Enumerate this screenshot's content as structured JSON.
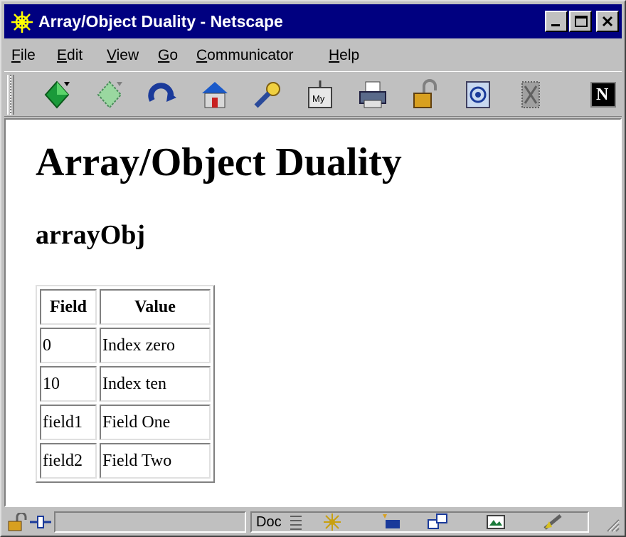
{
  "window": {
    "title": "Array/Object Duality - Netscape",
    "accent": "#000080"
  },
  "menu": [
    {
      "pre": "",
      "ul": "F",
      "post": "ile"
    },
    {
      "pre": "",
      "ul": "E",
      "post": "dit"
    },
    {
      "pre": "",
      "ul": "V",
      "post": "iew"
    },
    {
      "pre": "",
      "ul": "G",
      "post": "o"
    },
    {
      "pre": "",
      "ul": "C",
      "post": "ommunicator"
    },
    {
      "pre": "",
      "ul": "H",
      "post": "elp"
    }
  ],
  "toolbar": {
    "icons": [
      "back-icon",
      "forward-icon",
      "reload-icon",
      "home-icon",
      "search-icon",
      "my-netscape-icon",
      "print-icon",
      "security-icon",
      "shop-icon",
      "stop-icon"
    ],
    "my_label": "My",
    "logo_letter": "N"
  },
  "page": {
    "heading": "Array/Object Duality",
    "subheading": "arrayObj",
    "table": {
      "headers": [
        "Field",
        "Value"
      ],
      "rows": [
        [
          "0",
          "Index zero"
        ],
        [
          "10",
          "Index ten"
        ],
        [
          "field1",
          "Field One"
        ],
        [
          "field2",
          "Field Two"
        ]
      ]
    }
  },
  "status": {
    "doc_label": "Doc"
  }
}
